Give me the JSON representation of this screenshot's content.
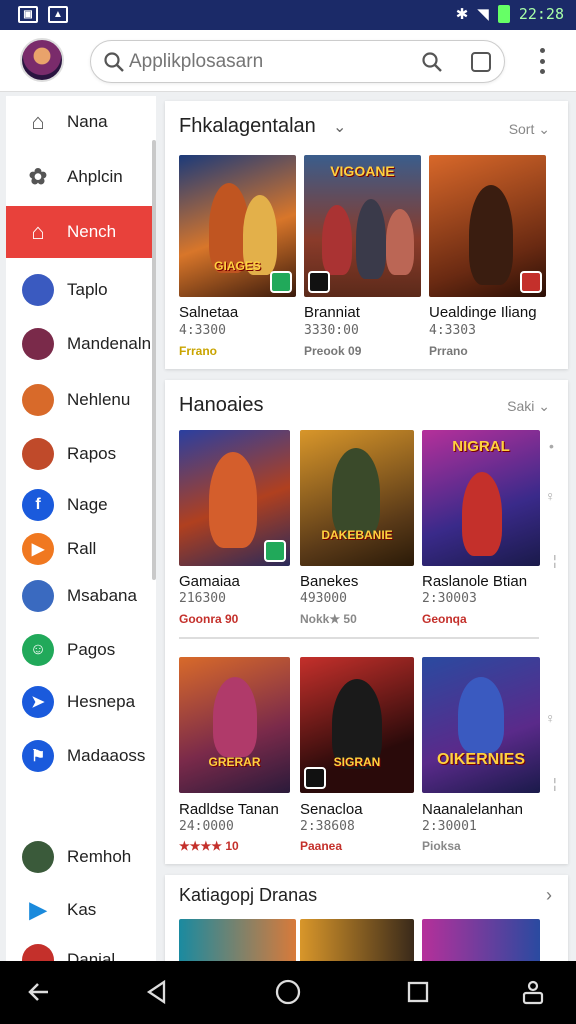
{
  "status": {
    "time": "22:28"
  },
  "search": {
    "placeholder": "Applikplosasarn"
  },
  "sidebar": {
    "items": [
      {
        "label": "Nana",
        "icon": "home-outline-icon"
      },
      {
        "label": "Ahplcin",
        "icon": "apps-icon"
      },
      {
        "label": "Nench",
        "icon": "home-icon"
      },
      {
        "label": "Taplo",
        "icon": "avatar-icon"
      },
      {
        "label": "Mandenaln",
        "icon": "avatar-icon"
      },
      {
        "label": "Nehlenu",
        "icon": "avatar-icon"
      },
      {
        "label": "Rapos",
        "icon": "avatar-icon"
      },
      {
        "label": "Nage",
        "icon": "facebook-icon"
      },
      {
        "label": "Rall",
        "icon": "play-icon"
      },
      {
        "label": "Msabana",
        "icon": "avatar-icon"
      },
      {
        "label": "Pagos",
        "icon": "robot-icon"
      },
      {
        "label": "Hesnepa",
        "icon": "send-icon"
      },
      {
        "label": "Madaaoss",
        "icon": "flag-icon"
      },
      {
        "label": "Remhoh",
        "icon": "avatar-icon"
      },
      {
        "label": "Kas",
        "icon": "play-triangle-icon"
      },
      {
        "label": "Danial",
        "icon": "avatar-icon"
      }
    ]
  },
  "section1": {
    "title": "Fhkalagentalan",
    "sort": "Sort",
    "games": [
      {
        "name": "Salnetaa",
        "num": "4:3300",
        "meta": "Frrano"
      },
      {
        "name": "Branniat",
        "num": "3330:00",
        "meta": "Preook 09"
      },
      {
        "name": "Uealdinge Iliang",
        "num": "4:3303",
        "meta": "Prrano"
      }
    ],
    "captions": [
      "GIAGES",
      "VIGOANE",
      ""
    ]
  },
  "section2": {
    "title": "Hanoaies",
    "sort": "Saki",
    "games": [
      {
        "name": "Gamaiaa",
        "num": "216300",
        "meta": "Goonra 90"
      },
      {
        "name": "Banekes",
        "num": "493000",
        "meta": "Nokk★ 50"
      },
      {
        "name": "Raslanole Btian",
        "num": "2:30003",
        "meta": "Geonqa"
      },
      {
        "name": "Radldse Tanan",
        "num": "24:0000",
        "meta": "★★★★ 10"
      },
      {
        "name": "Senacloa",
        "num": "2:38608",
        "meta": "Paanea"
      },
      {
        "name": "Naanalelanhan",
        "num": "2:30001",
        "meta": "Pioksa"
      }
    ],
    "captions": [
      "",
      "DAKEBANIE",
      "NIGRAL",
      "GRERAR",
      "SIGRAN",
      "OIKERNIES"
    ]
  },
  "section3": {
    "title": "Katiagopj Dranas"
  },
  "colors": {
    "accent": "#e8413b",
    "statusbar": "#1b2a68"
  }
}
